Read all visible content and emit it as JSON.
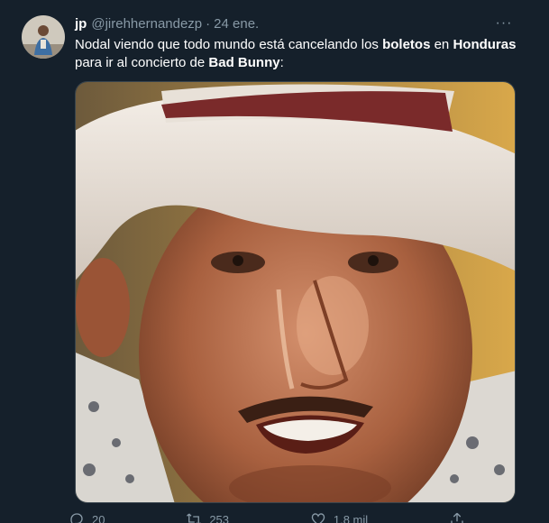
{
  "tweet": {
    "display_name": "jp",
    "handle": "@jirehhernandezp",
    "separator": "·",
    "date": "24 ene.",
    "more_label": "···",
    "text": {
      "part1": "Nodal viendo que todo mundo está cancelando los ",
      "bold1": "boletos",
      "part2": " en ",
      "bold2": "Honduras",
      "part3": " para ir al concierto de ",
      "bold3": "Bad Bunny",
      "part4": ":"
    },
    "media": {
      "description_icon": "photo-meme"
    }
  },
  "actions": {
    "reply_count": "20",
    "retweet_count": "253",
    "like_count": "1,8 mil",
    "icons": [
      "reply-icon",
      "retweet-icon",
      "like-icon",
      "share-icon"
    ]
  },
  "colors": {
    "background": "#15202b",
    "secondary_text": "#8899a6",
    "border": "#38444d"
  }
}
